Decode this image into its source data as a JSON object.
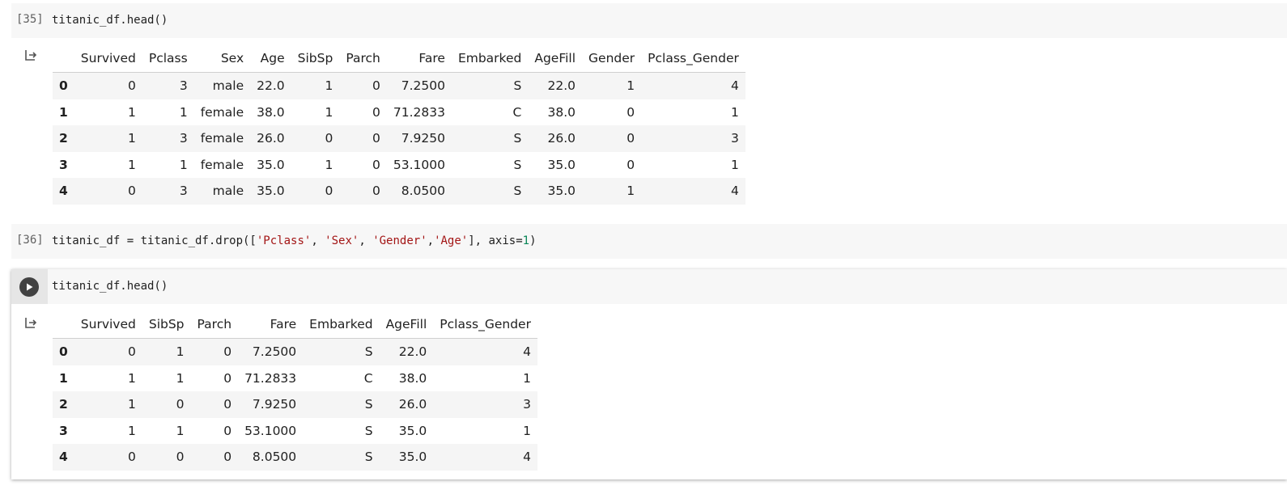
{
  "cells": [
    {
      "exec_count": "[35]",
      "code": "titanic_df.head()",
      "table": {
        "columns": [
          "",
          "Survived",
          "Pclass",
          "Sex",
          "Age",
          "SibSp",
          "Parch",
          "Fare",
          "Embarked",
          "AgeFill",
          "Gender",
          "Pclass_Gender"
        ],
        "rows": [
          [
            "0",
            "0",
            "3",
            "male",
            "22.0",
            "1",
            "0",
            "7.2500",
            "S",
            "22.0",
            "1",
            "4"
          ],
          [
            "1",
            "1",
            "1",
            "female",
            "38.0",
            "1",
            "0",
            "71.2833",
            "C",
            "38.0",
            "0",
            "1"
          ],
          [
            "2",
            "1",
            "3",
            "female",
            "26.0",
            "0",
            "0",
            "7.9250",
            "S",
            "26.0",
            "0",
            "3"
          ],
          [
            "3",
            "1",
            "1",
            "female",
            "35.0",
            "1",
            "0",
            "53.1000",
            "S",
            "35.0",
            "0",
            "1"
          ],
          [
            "4",
            "0",
            "3",
            "male",
            "35.0",
            "0",
            "0",
            "8.0500",
            "S",
            "35.0",
            "1",
            "4"
          ]
        ]
      }
    },
    {
      "exec_count": "[36]",
      "code_parts": {
        "p1": "titanic_df = titanic_df.drop([",
        "s1": "'Pclass'",
        "p2": ", ",
        "s2": "'Sex'",
        "p3": ", ",
        "s3": "'Gender'",
        "p4": ",",
        "s4": "'Age'",
        "p5": "], axis=",
        "n1": "1",
        "p6": ")"
      }
    },
    {
      "code": "titanic_df.head()",
      "table": {
        "columns": [
          "",
          "Survived",
          "SibSp",
          "Parch",
          "Fare",
          "Embarked",
          "AgeFill",
          "Pclass_Gender"
        ],
        "rows": [
          [
            "0",
            "0",
            "1",
            "0",
            "7.2500",
            "S",
            "22.0",
            "4"
          ],
          [
            "1",
            "1",
            "1",
            "0",
            "71.2833",
            "C",
            "38.0",
            "1"
          ],
          [
            "2",
            "1",
            "0",
            "0",
            "7.9250",
            "S",
            "26.0",
            "3"
          ],
          [
            "3",
            "1",
            "1",
            "0",
            "53.1000",
            "S",
            "35.0",
            "1"
          ],
          [
            "4",
            "0",
            "0",
            "0",
            "8.0500",
            "S",
            "35.0",
            "4"
          ]
        ]
      }
    }
  ],
  "icons": {
    "output": "output-redirect-icon",
    "run": "play-icon"
  },
  "colors": {
    "code_bg": "#f7f7f7",
    "string": "#a31515",
    "number": "#098658",
    "row_stripe": "#f5f5f5"
  }
}
